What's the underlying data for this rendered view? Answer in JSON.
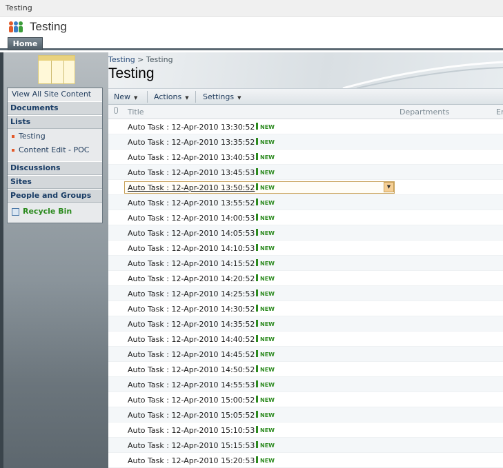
{
  "window": {
    "title": "Testing"
  },
  "site": {
    "name": "Testing"
  },
  "tabs": [
    {
      "label": "Home"
    }
  ],
  "breadcrumb": {
    "root": "Testing",
    "separator": ">",
    "current": "Testing"
  },
  "page": {
    "title": "Testing"
  },
  "nav": {
    "view_all": "View All Site Content",
    "sections": [
      "Documents",
      "Lists",
      "Discussions",
      "Sites",
      "People and Groups"
    ],
    "lists_items": [
      "Testing",
      "Content Edit - POC"
    ],
    "recycle": "Recycle Bin"
  },
  "toolbar": {
    "new": "New",
    "actions": "Actions",
    "settings": "Settings"
  },
  "columns": {
    "title": "Title",
    "departments": "Departments",
    "partial": "Er"
  },
  "new_badge": "NEW",
  "rows": [
    "Auto Task : 12-Apr-2010 13:30:52",
    "Auto Task : 12-Apr-2010 13:35:52",
    "Auto Task : 12-Apr-2010 13:40:53",
    "Auto Task : 12-Apr-2010 13:45:53",
    "Auto Task : 12-Apr-2010 13:50:52",
    "Auto Task : 12-Apr-2010 13:55:52",
    "Auto Task : 12-Apr-2010 14:00:53",
    "Auto Task : 12-Apr-2010 14:05:53",
    "Auto Task : 12-Apr-2010 14:10:53",
    "Auto Task : 12-Apr-2010 14:15:52",
    "Auto Task : 12-Apr-2010 14:20:52",
    "Auto Task : 12-Apr-2010 14:25:53",
    "Auto Task : 12-Apr-2010 14:30:52",
    "Auto Task : 12-Apr-2010 14:35:52",
    "Auto Task : 12-Apr-2010 14:40:52",
    "Auto Task : 12-Apr-2010 14:45:52",
    "Auto Task : 12-Apr-2010 14:50:52",
    "Auto Task : 12-Apr-2010 14:55:53",
    "Auto Task : 12-Apr-2010 15:00:52",
    "Auto Task : 12-Apr-2010 15:05:52",
    "Auto Task : 12-Apr-2010 15:10:53",
    "Auto Task : 12-Apr-2010 15:15:53",
    "Auto Task : 12-Apr-2010 15:20:53"
  ],
  "selected_row": 4
}
